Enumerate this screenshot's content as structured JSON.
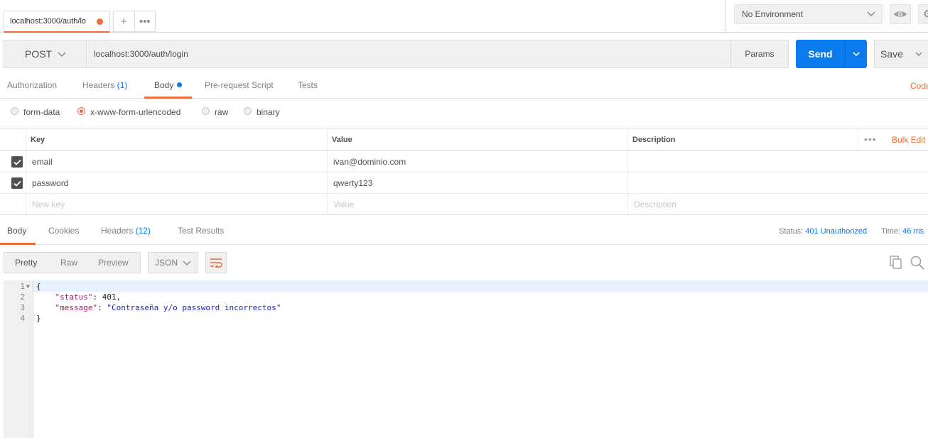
{
  "tabs": {
    "active_tab_label": "localhost:3000/auth/lo",
    "add_icon": "plus",
    "more_icon": "ellipsis"
  },
  "environment": {
    "selected": "No Environment"
  },
  "request": {
    "method": "POST",
    "url": "localhost:3000/auth/login",
    "params_label": "Params",
    "send_label": "Send",
    "save_label": "Save"
  },
  "request_tabs": [
    {
      "label": "Authorization",
      "count": ""
    },
    {
      "label": "Headers",
      "count": "(1)"
    },
    {
      "label": "Body",
      "count": ""
    },
    {
      "label": "Pre-request Script",
      "count": ""
    },
    {
      "label": "Tests",
      "count": ""
    }
  ],
  "code_link": "Code",
  "body_types": [
    {
      "label": "form-data",
      "selected": false
    },
    {
      "label": "x-www-form-urlencoded",
      "selected": true
    },
    {
      "label": "raw",
      "selected": false
    },
    {
      "label": "binary",
      "selected": false
    }
  ],
  "params_table": {
    "headers": [
      "Key",
      "Value",
      "Description"
    ],
    "bulk_edit": "Bulk Edit",
    "rows": [
      {
        "checked": true,
        "key": "email",
        "value": "ivan@dominio.com",
        "description": ""
      },
      {
        "checked": true,
        "key": "password",
        "value": "qwerty123",
        "description": ""
      }
    ],
    "placeholder": {
      "key": "New key",
      "value": "Value",
      "description": "Description"
    }
  },
  "response_tabs": [
    {
      "label": "Body",
      "count": ""
    },
    {
      "label": "Cookies",
      "count": ""
    },
    {
      "label": "Headers",
      "count": "(12)"
    },
    {
      "label": "Test Results",
      "count": ""
    }
  ],
  "response_meta": {
    "status_label": "Status:",
    "status_value": "401 Unauthorized",
    "time_label": "Time:",
    "time_value": "46 ms"
  },
  "response_view": {
    "formats": [
      "Pretty",
      "Raw",
      "Preview"
    ],
    "language": "JSON"
  },
  "response_code": {
    "line_numbers": [
      "1",
      "2",
      "3",
      "4"
    ],
    "open_brace": "{",
    "status_key": "\"status\"",
    "status_value": "401",
    "message_key": "\"message\"",
    "message_value": "\"Contraseña y/o password incorrectos\"",
    "close_brace": "}"
  },
  "colors": {
    "accent": "#f26b3a",
    "primary": "#097bed"
  }
}
